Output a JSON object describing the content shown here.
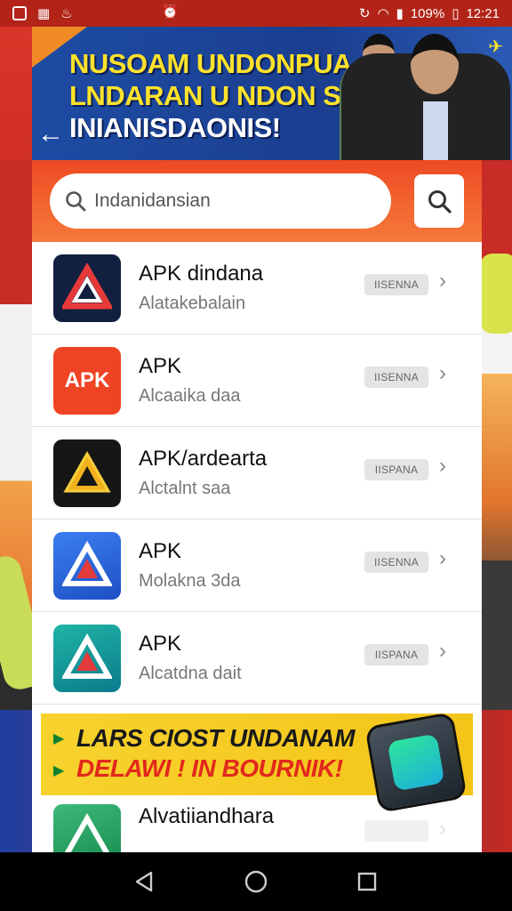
{
  "status_bar": {
    "battery": "109%",
    "time": "12:21"
  },
  "banner": {
    "title_line1": "NUSOAM UNDONPUA",
    "title_line2": "LNDARAN U NDON SAN",
    "title_line3": "INIANISDAONIS!"
  },
  "search": {
    "value": "Indanidansian",
    "placeholder": "Indanidansian"
  },
  "apps": [
    {
      "title": "APK dindana",
      "subtitle": "Alatakebalain",
      "badge": "IISENNA",
      "icon": "apk-triangle-logo",
      "icon_text": "",
      "icon_bg": "#12203f"
    },
    {
      "title": "APK",
      "subtitle": "Alcaaika daa",
      "badge": "IISENNA",
      "icon": "apk-text-logo",
      "icon_text": "APK",
      "icon_bg": "#ef4424"
    },
    {
      "title": "APK/ardearta",
      "subtitle": "Alctalnt saa",
      "badge": "IISPANA",
      "icon": "apk-gold-triangle-logo",
      "icon_text": "",
      "icon_bg": "#161616"
    },
    {
      "title": "APK",
      "subtitle": "Molakna 3da",
      "badge": "IISENNA",
      "icon": "apk-blue-triangle-logo",
      "icon_text": "",
      "icon_bg": "#2b63d8"
    },
    {
      "title": "APK",
      "subtitle": "Alcatdna dait",
      "badge": "IISPANA",
      "icon": "apk-teal-triangle-logo",
      "icon_text": "",
      "icon_bg": "#14998f"
    }
  ],
  "ad": {
    "line1": "LARS CIOST UNDANAM",
    "line2": "DELAWI ! IN BOURNIK!"
  },
  "partial_app": {
    "title": "Alvatiiandhara",
    "icon": "apk-green-triangle-logo"
  },
  "colors": {
    "accent": "#ee4a23",
    "status_bar": "#b22418",
    "banner": "#1d4ca3",
    "banner_text": "#ffe22b"
  }
}
